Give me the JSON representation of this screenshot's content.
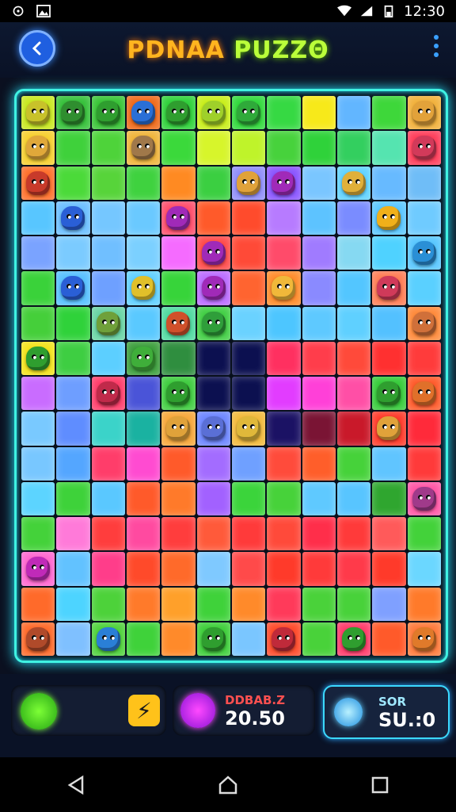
{
  "status": {
    "time": "12:30"
  },
  "header": {
    "title_part1": "PDNAA",
    "title_part2": "PUZZΘ"
  },
  "board": {
    "rows": [
      [
        "#c8e81e",
        "#36c13a",
        "#38c436",
        "#f06a1a",
        "#2fd23a",
        "#c9ef1a",
        "#30d93b",
        "#36d943",
        "#f7e91a",
        "#62b6ff",
        "#3ed73a",
        "#f2b13b"
      ],
      [
        "#f7cf2e",
        "#3fd13b",
        "#4ed33a",
        "#f0b43a",
        "#3bd93b",
        "#d7f52b",
        "#bff32a",
        "#47d23c",
        "#2fd23a",
        "#33cf5f",
        "#55e4b0",
        "#ff3d5a"
      ],
      [
        "#ff6f2a",
        "#4bda39",
        "#57d43a",
        "#3fd23f",
        "#ff8a22",
        "#3bcf41",
        "#8f8dfa",
        "#8a55ff",
        "#7ac6ff",
        "#60d3ff",
        "#67baff",
        "#6fbdf7"
      ],
      [
        "#58c6ff",
        "#6bbfff",
        "#75c7ff",
        "#6ac9ff",
        "#ff4d6b",
        "#ff5a2a",
        "#ff4b2c",
        "#b77bff",
        "#5dc3ff",
        "#7a8cff",
        "#5ac7ff",
        "#6fcbff"
      ],
      [
        "#7aa3ff",
        "#7bcbff",
        "#70bfff",
        "#7bd0ff",
        "#f56bff",
        "#ff4a4a",
        "#ff4a37",
        "#ff4b6a",
        "#a07bff",
        "#86d9f2",
        "#4fd2ff",
        "#58c7ff"
      ],
      [
        "#3ad23a",
        "#57c0ff",
        "#6ea0ff",
        "#60d0ff",
        "#37d43a",
        "#bb6cff",
        "#ff6430",
        "#ff8c2b",
        "#8a8aff",
        "#53c6ff",
        "#ff7d55",
        "#5ad0ff"
      ],
      [
        "#45cf3a",
        "#2fd23a",
        "#67d3a3",
        "#5ac9ff",
        "#4fd9a0",
        "#41cf44",
        "#6ad2ff",
        "#4dc6ff",
        "#5ec9ff",
        "#5fd0ff",
        "#53c1ff",
        "#ff8a3a"
      ],
      [
        "#f3e31a",
        "#3ece42",
        "#5ccfff",
        "#3b9e3b",
        "#2f8e3f",
        "#0c1050",
        "#0c1050",
        "#ff3060",
        "#ff3d4b",
        "#ff4a3a",
        "#ff3030",
        "#ff3b3b"
      ],
      [
        "#c96cff",
        "#6e9eff",
        "#ff3c6a",
        "#4a54d8",
        "#3fcd3f",
        "#0c1050",
        "#0c1050",
        "#e23cff",
        "#ff40d8",
        "#ff4fa6",
        "#36cc3a",
        "#ff5a2a"
      ],
      [
        "#79c9ff",
        "#5f8dff",
        "#3bd3c9",
        "#1ab2a1",
        "#f7a83a",
        "#6d86ff",
        "#f2ba3a",
        "#1b1264",
        "#7a1434",
        "#c9192a",
        "#ff3a2a",
        "#ff2a3a"
      ],
      [
        "#78c7ff",
        "#54a6ff",
        "#ff3d6a",
        "#ff4bd1",
        "#ff5a2a",
        "#a36cff",
        "#6fa0ff",
        "#ff4b3b",
        "#ff5e2a",
        "#46d23a",
        "#60c5ff",
        "#ff3a3a"
      ],
      [
        "#5cd4ff",
        "#3ed23a",
        "#5ac8ff",
        "#ff5a2a",
        "#ff7a2a",
        "#a261ff",
        "#3bd43b",
        "#47d23a",
        "#5fc9ff",
        "#58c5ff",
        "#2fa62f",
        "#ff56a6"
      ],
      [
        "#44d23a",
        "#ff7ad9",
        "#ff3d3d",
        "#ff4aa0",
        "#ff3d3d",
        "#ff5a3a",
        "#ff3a3a",
        "#ff4a3a",
        "#ff2e4a",
        "#ff3a3a",
        "#ff5a5a",
        "#43d23a"
      ],
      [
        "#ff66d0",
        "#62c2ff",
        "#ff3d8a",
        "#ff4a2a",
        "#ff6a2a",
        "#7fc9ff",
        "#ff4a4a",
        "#ff3a2a",
        "#ff3a3a",
        "#ff3a4a",
        "#ff3a2a",
        "#6bd7ff"
      ],
      [
        "#ff6a2a",
        "#4dd4ff",
        "#4dd23a",
        "#ff7a2a",
        "#ffa02a",
        "#3fd23a",
        "#ff8a2a",
        "#ff3a5a",
        "#4ad23a",
        "#48d23a",
        "#7fa0ff",
        "#ff7a2a"
      ],
      [
        "#ff6a2a",
        "#7fc0ff",
        "#4ed23a",
        "#3fd23a",
        "#ff8a2a",
        "#3ecf3a",
        "#7ac6ff",
        "#ff4a2a",
        "#49d23a",
        "#ff3a6a",
        "#ff5a2a",
        "#ff7a3a"
      ]
    ],
    "monsters": [
      {
        "r": 0,
        "c": 0,
        "color": "#c8c22a"
      },
      {
        "r": 0,
        "c": 1,
        "color": "#2f8e2f"
      },
      {
        "r": 0,
        "c": 2,
        "color": "#2f9e2f"
      },
      {
        "r": 0,
        "c": 3,
        "color": "#2a6fd6"
      },
      {
        "r": 0,
        "c": 4,
        "color": "#2f9e2f"
      },
      {
        "r": 0,
        "c": 5,
        "color": "#9fd02a"
      },
      {
        "r": 0,
        "c": 6,
        "color": "#2faa3a"
      },
      {
        "r": 0,
        "c": 11,
        "color": "#e2a23a"
      },
      {
        "r": 1,
        "c": 0,
        "color": "#e0a83a"
      },
      {
        "r": 1,
        "c": 3,
        "color": "#a0784a"
      },
      {
        "r": 1,
        "c": 11,
        "color": "#d23a5a"
      },
      {
        "r": 2,
        "c": 0,
        "color": "#c83a2a"
      },
      {
        "r": 2,
        "c": 6,
        "color": "#e0a23a"
      },
      {
        "r": 2,
        "c": 7,
        "color": "#a02ab8"
      },
      {
        "r": 2,
        "c": 9,
        "color": "#e0b03a"
      },
      {
        "r": 3,
        "c": 1,
        "color": "#2a5fd6"
      },
      {
        "r": 3,
        "c": 4,
        "color": "#a02ab8"
      },
      {
        "r": 3,
        "c": 10,
        "color": "#f0b01a"
      },
      {
        "r": 4,
        "c": 5,
        "color": "#9f2ab8"
      },
      {
        "r": 4,
        "c": 11,
        "color": "#2a8fd6"
      },
      {
        "r": 5,
        "c": 1,
        "color": "#2a5fd6"
      },
      {
        "r": 5,
        "c": 3,
        "color": "#e0c02a"
      },
      {
        "r": 5,
        "c": 5,
        "color": "#a02ab8"
      },
      {
        "r": 5,
        "c": 7,
        "color": "#f0b83a"
      },
      {
        "r": 5,
        "c": 10,
        "color": "#d03a5a"
      },
      {
        "r": 6,
        "c": 2,
        "color": "#6fa03a"
      },
      {
        "r": 6,
        "c": 4,
        "color": "#d0502a"
      },
      {
        "r": 6,
        "c": 5,
        "color": "#2f9e3a"
      },
      {
        "r": 6,
        "c": 11,
        "color": "#d0703a"
      },
      {
        "r": 7,
        "c": 0,
        "color": "#2f9e2f"
      },
      {
        "r": 7,
        "c": 3,
        "color": "#3fae3a"
      },
      {
        "r": 8,
        "c": 2,
        "color": "#c02a4a"
      },
      {
        "r": 8,
        "c": 4,
        "color": "#2f9e2f"
      },
      {
        "r": 8,
        "c": 10,
        "color": "#2f9e2f"
      },
      {
        "r": 8,
        "c": 11,
        "color": "#e0702a"
      },
      {
        "r": 9,
        "c": 4,
        "color": "#e0a23a"
      },
      {
        "r": 9,
        "c": 5,
        "color": "#5a6fd6"
      },
      {
        "r": 9,
        "c": 6,
        "color": "#e0b83a"
      },
      {
        "r": 9,
        "c": 10,
        "color": "#e0a23a"
      },
      {
        "r": 11,
        "c": 11,
        "color": "#a03a8a"
      },
      {
        "r": 13,
        "c": 0,
        "color": "#c02ab8"
      },
      {
        "r": 15,
        "c": 0,
        "color": "#b04a2a"
      },
      {
        "r": 15,
        "c": 2,
        "color": "#2a7fd6"
      },
      {
        "r": 15,
        "c": 5,
        "color": "#2f9e2f"
      },
      {
        "r": 15,
        "c": 7,
        "color": "#c02a3a"
      },
      {
        "r": 15,
        "c": 9,
        "color": "#2f9e2f"
      },
      {
        "r": 15,
        "c": 11,
        "color": "#e07a2a"
      }
    ]
  },
  "footer": {
    "stat_label": "DDBAB.Z",
    "stat_value": "20.50",
    "score_label": "SOR",
    "score_value": "SU.:0",
    "bolt_icon": "⚡"
  }
}
